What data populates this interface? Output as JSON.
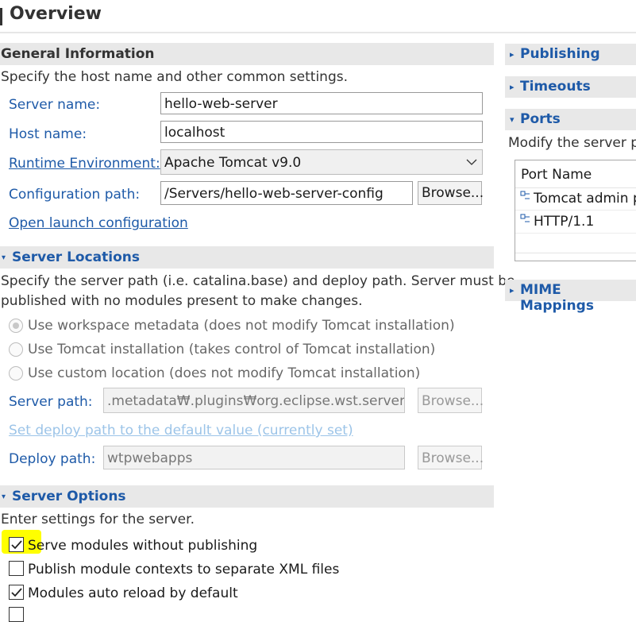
{
  "header": {
    "title": "Overview"
  },
  "general": {
    "title": "General Information",
    "description": "Specify the host name and other common settings.",
    "server_name_label": "Server name:",
    "server_name_value": "hello-web-server",
    "host_name_label": "Host name:",
    "host_name_value": "localhost",
    "runtime_label": "Runtime Environment:",
    "runtime_value": "Apache Tomcat v9.0",
    "config_path_label": "Configuration path:",
    "config_path_value": "/Servers/hello-web-server-config",
    "browse_label": "Browse...",
    "open_launch_label": "Open launch configuration"
  },
  "locations": {
    "title": "Server Locations",
    "description_line1": "Specify the server path (i.e. catalina.base) and deploy path. Server must be",
    "description_line2": "published with no modules present to make changes.",
    "options": [
      {
        "label": "Use workspace metadata (does not modify Tomcat installation)",
        "selected": true
      },
      {
        "label": "Use Tomcat installation (takes control of Tomcat installation)",
        "selected": false
      },
      {
        "label": "Use custom location (does not modify Tomcat installation)",
        "selected": false
      }
    ],
    "server_path_label": "Server path:",
    "server_path_value": ".metadata₩.plugins₩org.eclipse.wst.server.core",
    "browse_label": "Browse...",
    "set_deploy_label": "Set deploy path to the default value (currently set)",
    "deploy_path_label": "Deploy path:",
    "deploy_path_value": "wtpwebapps"
  },
  "options": {
    "title": "Server Options",
    "description": "Enter settings for the server.",
    "items": [
      {
        "label": "Serve modules without publishing",
        "checked": true
      },
      {
        "label": "Publish module contexts to separate XML files",
        "checked": false
      },
      {
        "label": "Modules auto reload by default",
        "checked": true
      }
    ]
  },
  "right": {
    "publishing_title": "Publishing",
    "timeouts_title": "Timeouts",
    "ports_title": "Ports",
    "ports_description": "Modify the server p",
    "ports_column": "Port Name",
    "ports_rows": [
      "Tomcat admin p",
      "HTTP/1.1"
    ],
    "mime_title": "MIME Mappings"
  },
  "colors": {
    "link": "#1e5aa8",
    "section_bg": "#e8e8e8",
    "highlight": "#ffff00"
  }
}
